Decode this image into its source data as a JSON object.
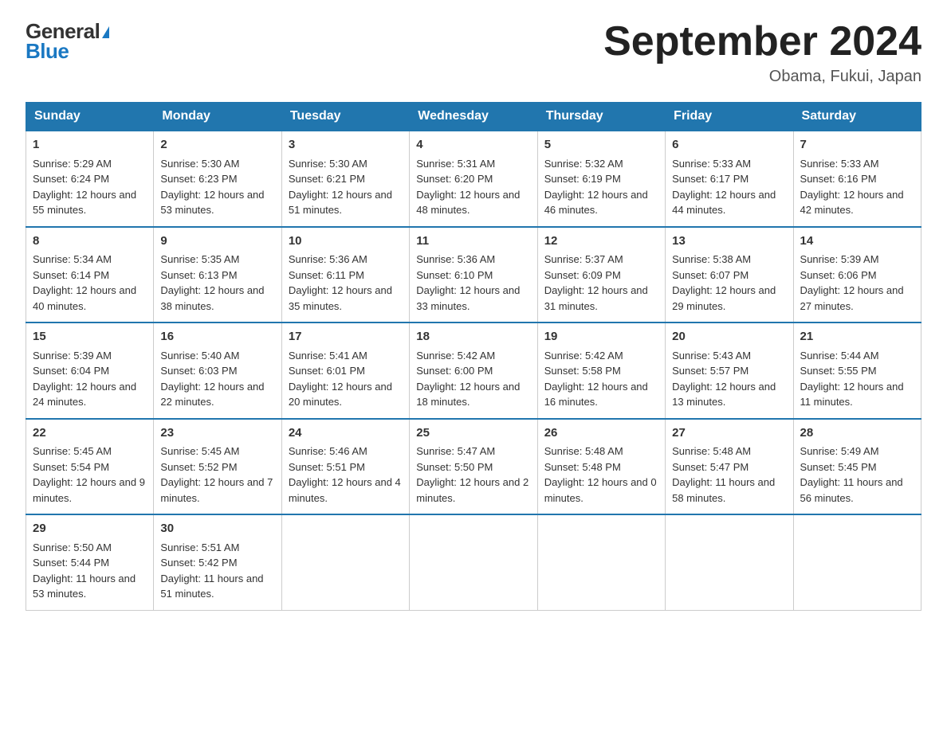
{
  "logo": {
    "general": "General",
    "blue": "Blue",
    "triangle": "▶"
  },
  "header": {
    "title": "September 2024",
    "location": "Obama, Fukui, Japan"
  },
  "days_of_week": [
    "Sunday",
    "Monday",
    "Tuesday",
    "Wednesday",
    "Thursday",
    "Friday",
    "Saturday"
  ],
  "weeks": [
    [
      {
        "day": "1",
        "sunrise": "5:29 AM",
        "sunset": "6:24 PM",
        "daylight": "12 hours and 55 minutes."
      },
      {
        "day": "2",
        "sunrise": "5:30 AM",
        "sunset": "6:23 PM",
        "daylight": "12 hours and 53 minutes."
      },
      {
        "day": "3",
        "sunrise": "5:30 AM",
        "sunset": "6:21 PM",
        "daylight": "12 hours and 51 minutes."
      },
      {
        "day": "4",
        "sunrise": "5:31 AM",
        "sunset": "6:20 PM",
        "daylight": "12 hours and 48 minutes."
      },
      {
        "day": "5",
        "sunrise": "5:32 AM",
        "sunset": "6:19 PM",
        "daylight": "12 hours and 46 minutes."
      },
      {
        "day": "6",
        "sunrise": "5:33 AM",
        "sunset": "6:17 PM",
        "daylight": "12 hours and 44 minutes."
      },
      {
        "day": "7",
        "sunrise": "5:33 AM",
        "sunset": "6:16 PM",
        "daylight": "12 hours and 42 minutes."
      }
    ],
    [
      {
        "day": "8",
        "sunrise": "5:34 AM",
        "sunset": "6:14 PM",
        "daylight": "12 hours and 40 minutes."
      },
      {
        "day": "9",
        "sunrise": "5:35 AM",
        "sunset": "6:13 PM",
        "daylight": "12 hours and 38 minutes."
      },
      {
        "day": "10",
        "sunrise": "5:36 AM",
        "sunset": "6:11 PM",
        "daylight": "12 hours and 35 minutes."
      },
      {
        "day": "11",
        "sunrise": "5:36 AM",
        "sunset": "6:10 PM",
        "daylight": "12 hours and 33 minutes."
      },
      {
        "day": "12",
        "sunrise": "5:37 AM",
        "sunset": "6:09 PM",
        "daylight": "12 hours and 31 minutes."
      },
      {
        "day": "13",
        "sunrise": "5:38 AM",
        "sunset": "6:07 PM",
        "daylight": "12 hours and 29 minutes."
      },
      {
        "day": "14",
        "sunrise": "5:39 AM",
        "sunset": "6:06 PM",
        "daylight": "12 hours and 27 minutes."
      }
    ],
    [
      {
        "day": "15",
        "sunrise": "5:39 AM",
        "sunset": "6:04 PM",
        "daylight": "12 hours and 24 minutes."
      },
      {
        "day": "16",
        "sunrise": "5:40 AM",
        "sunset": "6:03 PM",
        "daylight": "12 hours and 22 minutes."
      },
      {
        "day": "17",
        "sunrise": "5:41 AM",
        "sunset": "6:01 PM",
        "daylight": "12 hours and 20 minutes."
      },
      {
        "day": "18",
        "sunrise": "5:42 AM",
        "sunset": "6:00 PM",
        "daylight": "12 hours and 18 minutes."
      },
      {
        "day": "19",
        "sunrise": "5:42 AM",
        "sunset": "5:58 PM",
        "daylight": "12 hours and 16 minutes."
      },
      {
        "day": "20",
        "sunrise": "5:43 AM",
        "sunset": "5:57 PM",
        "daylight": "12 hours and 13 minutes."
      },
      {
        "day": "21",
        "sunrise": "5:44 AM",
        "sunset": "5:55 PM",
        "daylight": "12 hours and 11 minutes."
      }
    ],
    [
      {
        "day": "22",
        "sunrise": "5:45 AM",
        "sunset": "5:54 PM",
        "daylight": "12 hours and 9 minutes."
      },
      {
        "day": "23",
        "sunrise": "5:45 AM",
        "sunset": "5:52 PM",
        "daylight": "12 hours and 7 minutes."
      },
      {
        "day": "24",
        "sunrise": "5:46 AM",
        "sunset": "5:51 PM",
        "daylight": "12 hours and 4 minutes."
      },
      {
        "day": "25",
        "sunrise": "5:47 AM",
        "sunset": "5:50 PM",
        "daylight": "12 hours and 2 minutes."
      },
      {
        "day": "26",
        "sunrise": "5:48 AM",
        "sunset": "5:48 PM",
        "daylight": "12 hours and 0 minutes."
      },
      {
        "day": "27",
        "sunrise": "5:48 AM",
        "sunset": "5:47 PM",
        "daylight": "11 hours and 58 minutes."
      },
      {
        "day": "28",
        "sunrise": "5:49 AM",
        "sunset": "5:45 PM",
        "daylight": "11 hours and 56 minutes."
      }
    ],
    [
      {
        "day": "29",
        "sunrise": "5:50 AM",
        "sunset": "5:44 PM",
        "daylight": "11 hours and 53 minutes."
      },
      {
        "day": "30",
        "sunrise": "5:51 AM",
        "sunset": "5:42 PM",
        "daylight": "11 hours and 51 minutes."
      },
      null,
      null,
      null,
      null,
      null
    ]
  ],
  "labels": {
    "sunrise_prefix": "Sunrise: ",
    "sunset_prefix": "Sunset: ",
    "daylight_prefix": "Daylight: "
  }
}
